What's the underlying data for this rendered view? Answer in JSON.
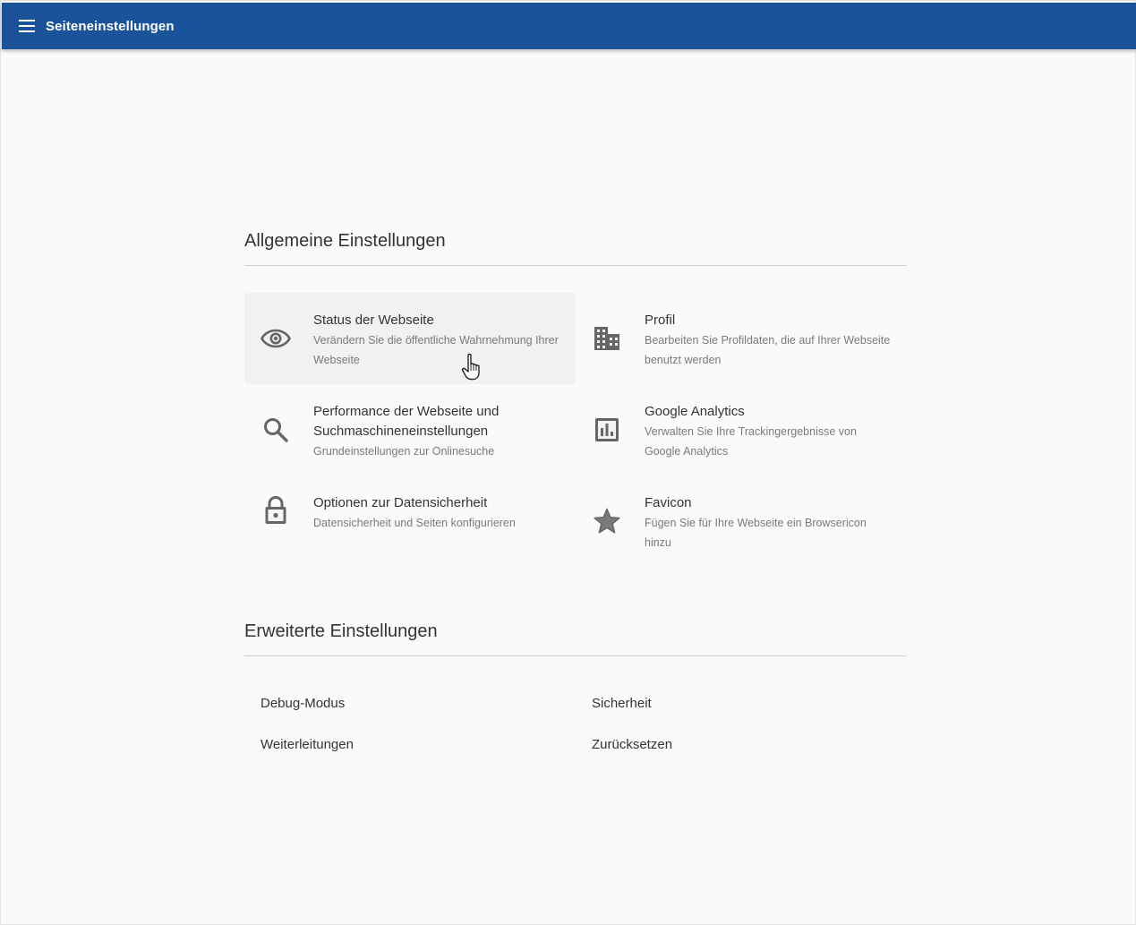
{
  "topbar": {
    "title": "Seiteneinstellungen",
    "menu_icon": "menu-icon",
    "color": "#1b539b"
  },
  "general": {
    "heading": "Allgemeine Einstellungen",
    "cards": [
      {
        "title": "Status der Webseite",
        "desc": "Verändern Sie die öffentliche Wahrnehmung Ihrer Webseite",
        "icon": "eye-icon",
        "hovered": true
      },
      {
        "title": "Profil",
        "desc": "Bearbeiten Sie Profildaten, die auf Ihrer Webseite benutzt werden",
        "icon": "building-icon"
      },
      {
        "title": "Performance der Webseite und Suchmaschineneinstellungen",
        "desc": "Grundeinstellungen zur Onlinesuche",
        "icon": "search-icon"
      },
      {
        "title": "Google Analytics",
        "desc": "Verwalten Sie Ihre Trackingergebnisse von Google Analytics",
        "icon": "bar-chart-icon"
      },
      {
        "title": "Optionen zur Datensicherheit",
        "desc": "Datensicherheit und Seiten konfigurieren",
        "icon": "lock-icon"
      },
      {
        "title": "Favicon",
        "desc": "Fügen Sie für Ihre Webseite ein Browsericon hinzu",
        "icon": "star-icon"
      }
    ]
  },
  "advanced": {
    "heading": "Erweiterte Einstellungen",
    "links": [
      "Debug-Modus",
      "Sicherheit",
      "Weiterleitungen",
      "Zurücksetzen"
    ]
  }
}
